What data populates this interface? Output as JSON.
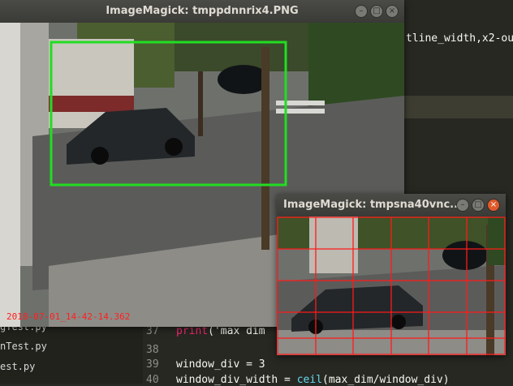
{
  "editor": {
    "top_code_fragment": "tline_width,x2-ou",
    "files": [
      "gTest.py",
      "nTest.py",
      "est.py"
    ],
    "line_numbers": [
      "37",
      "38",
      "39",
      "40"
    ],
    "code": {
      "line37_keyword": "print",
      "line37_rest": "('max dim",
      "line39": "window_div = 3",
      "line40_a": "window_div_width = ",
      "line40_fn": "ceil",
      "line40_b": "(max_dim/window_div)"
    }
  },
  "window_main": {
    "title": "ImageMagick: tmppdnnrix4.PNG",
    "timestamp": "2018-07-01_14-42-14.362",
    "box_color": "#22dd22"
  },
  "window_grid": {
    "title": "ImageMagick: tmpsna40vnc....",
    "grid_color": "#ff1a1a"
  },
  "colors": {
    "editor_bg": "#272822",
    "timestamp": "#ff2020"
  }
}
